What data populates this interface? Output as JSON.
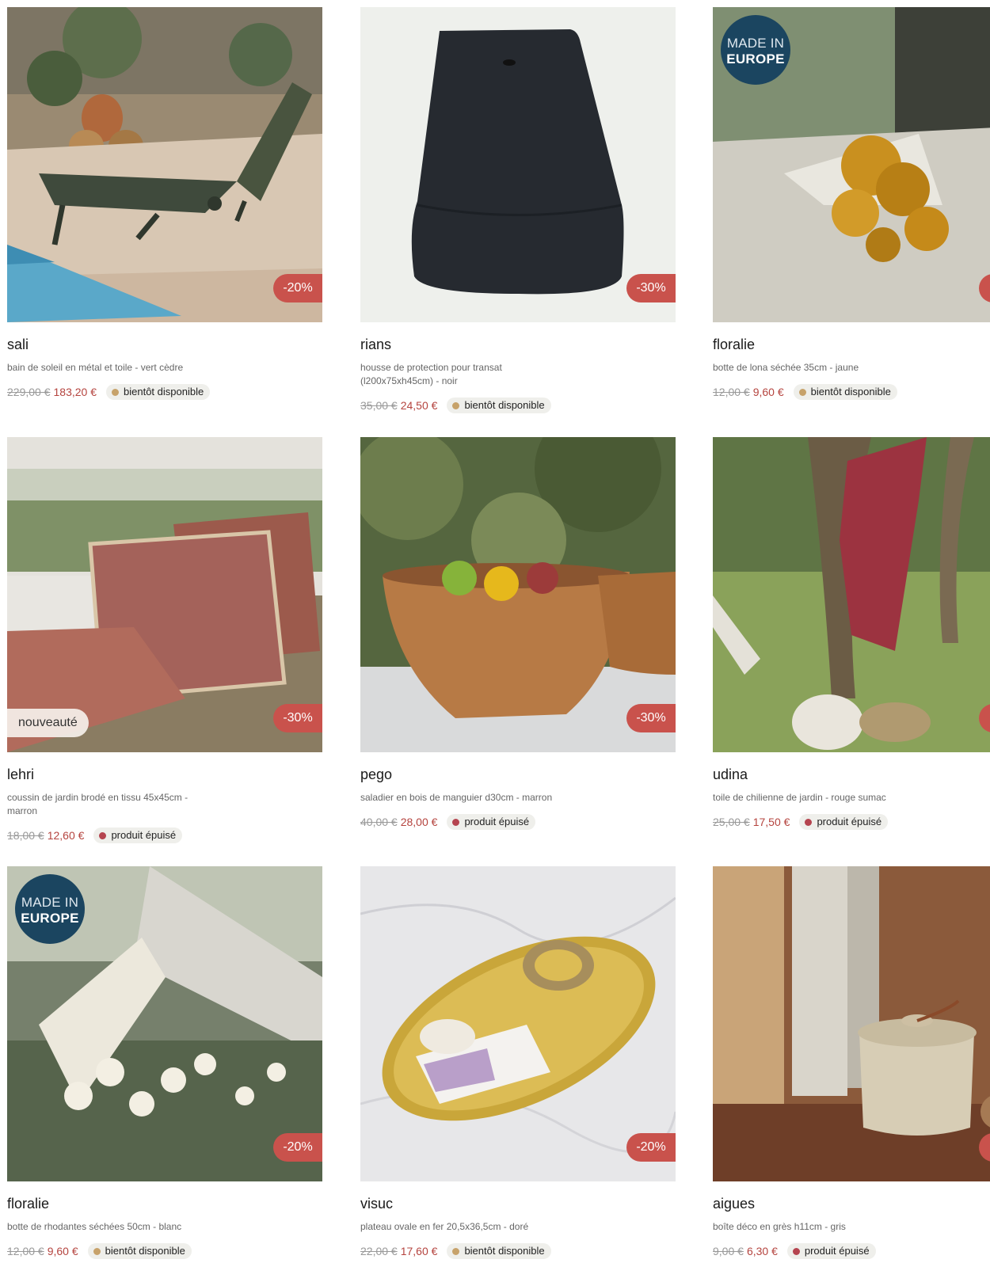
{
  "colors": {
    "discount_bg": "#c9524c",
    "sale_price": "#b5443f",
    "available_soon_dot": "#c7a26a",
    "sold_out_dot": "#b5444f",
    "europe_badge": "#1b4560"
  },
  "products": [
    {
      "name": "sali",
      "description": "bain de soleil en métal et toile - vert cèdre",
      "old_price": "229,00 €",
      "price": "183,20 €",
      "discount": "-20%",
      "availability": "bientôt disponible",
      "availability_status": "soon",
      "badge": "",
      "made_in_europe": false
    },
    {
      "name": "rians",
      "description": "housse de protection pour transat (l200x75xh45cm) - noir",
      "old_price": "35,00 €",
      "price": "24,50 €",
      "discount": "-30%",
      "availability": "bientôt disponible",
      "availability_status": "soon",
      "badge": "",
      "made_in_europe": false
    },
    {
      "name": "floralie",
      "description": "botte de lona séchée 35cm - jaune",
      "old_price": "12,00 €",
      "price": "9,60 €",
      "discount": "",
      "availability": "bientôt disponible",
      "availability_status": "soon",
      "badge": "",
      "made_in_europe": true
    },
    {
      "name": "lehri",
      "description": "coussin de jardin brodé en tissu 45x45cm - marron",
      "old_price": "18,00 €",
      "price": "12,60 €",
      "discount": "-30%",
      "availability": "produit épuisé",
      "availability_status": "sold_out",
      "badge": "nouveauté",
      "made_in_europe": false
    },
    {
      "name": "pego",
      "description": "saladier en bois de manguier d30cm - marron",
      "old_price": "40,00 €",
      "price": "28,00 €",
      "discount": "-30%",
      "availability": "produit épuisé",
      "availability_status": "sold_out",
      "badge": "",
      "made_in_europe": false
    },
    {
      "name": "udina",
      "description": "toile de chilienne de jardin - rouge sumac",
      "old_price": "25,00 €",
      "price": "17,50 €",
      "discount": "",
      "availability": "produit épuisé",
      "availability_status": "sold_out",
      "badge": "",
      "made_in_europe": false
    },
    {
      "name": "floralie",
      "description": "botte de rhodantes séchées 50cm - blanc",
      "old_price": "12,00 €",
      "price": "9,60 €",
      "discount": "-20%",
      "availability": "bientôt disponible",
      "availability_status": "soon",
      "badge": "",
      "made_in_europe": true
    },
    {
      "name": "visuc",
      "description": "plateau ovale en fer 20,5x36,5cm - doré",
      "old_price": "22,00 €",
      "price": "17,60 €",
      "discount": "-20%",
      "availability": "bientôt disponible",
      "availability_status": "soon",
      "badge": "",
      "made_in_europe": false
    },
    {
      "name": "aigues",
      "description": "boîte déco en grès h11cm - gris",
      "old_price": "9,00 €",
      "price": "6,30 €",
      "discount": "",
      "availability": "produit épuisé",
      "availability_status": "sold_out",
      "badge": "",
      "made_in_europe": false
    }
  ],
  "made_in_europe_badge": {
    "line1": "MADE IN",
    "line2": "EUROPE"
  }
}
